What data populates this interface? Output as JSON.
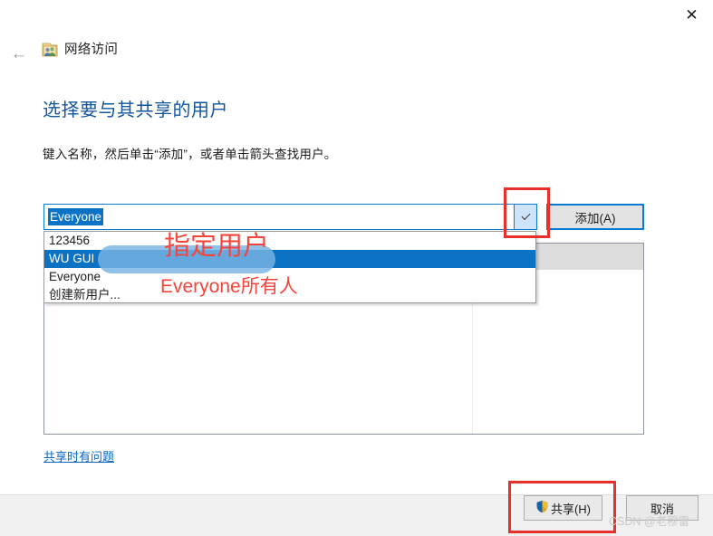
{
  "window": {
    "close_label": "✕",
    "back_label": "←",
    "title": "网络访问",
    "icon": "shared-folder-icon"
  },
  "page": {
    "heading": "选择要与其共享的用户",
    "subtext": "键入名称，然后单击“添加”，或者单击箭头查找用户。"
  },
  "combo": {
    "value": "Everyone",
    "placeholder": "",
    "dropdown_icon": "chevron-down-icon",
    "options": [
      "123456",
      "WU GUI",
      "Everyone",
      "创建新用户..."
    ],
    "selected_index": 1
  },
  "buttons": {
    "add": "添加(A)",
    "share": "共享(H)",
    "cancel": "取消",
    "share_icon": "uac-shield-icon"
  },
  "link": {
    "help": "共享时有问题"
  },
  "annotations": {
    "specify_user": "指定用户",
    "everyone_all": "Everyone所有人"
  },
  "watermark": "CSDN @老穆雷",
  "colors": {
    "accent": "#0b72c4",
    "heading": "#13559c",
    "annotation": "#f4453c",
    "footer": "#f0f0f0"
  }
}
